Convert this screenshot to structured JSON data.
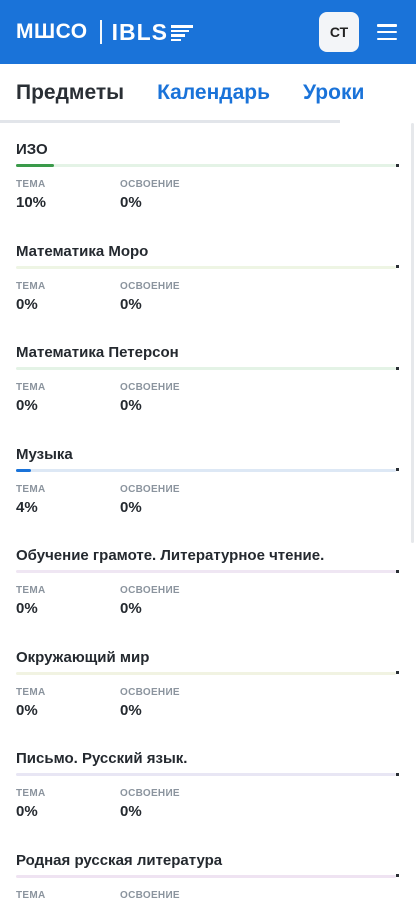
{
  "header": {
    "logo_left": "МШСО",
    "logo_right": "IBLS",
    "avatar_initials": "СТ",
    "menu_icon": "hamburger-icon"
  },
  "tabs": [
    {
      "label": "Предметы",
      "active": true
    },
    {
      "label": "Календарь",
      "active": false
    },
    {
      "label": "Уроки",
      "active": false
    }
  ],
  "column_labels": {
    "topic": "ТЕМА",
    "mastery": "ОСВОЕНИЕ"
  },
  "subjects": [
    {
      "name": "ИЗО",
      "topic": "10%",
      "mastery": "0%",
      "progress": 0.1,
      "track_color": "#e4f3e6",
      "fill_color": "#3a9a4a"
    },
    {
      "name": "Математика Моро",
      "topic": "0%",
      "mastery": "0%",
      "progress": 0,
      "track_color": "#eef5e4",
      "fill_color": "#8bc34a"
    },
    {
      "name": "Математика Петерсон",
      "topic": "0%",
      "mastery": "0%",
      "progress": 0,
      "track_color": "#e4f3e6",
      "fill_color": "#3a9a4a"
    },
    {
      "name": "Музыка",
      "topic": "4%",
      "mastery": "0%",
      "progress": 0.04,
      "track_color": "#dde8f5",
      "fill_color": "#1a73d9"
    },
    {
      "name": "Обучение грамоте. Литературное чтение.",
      "topic": "0%",
      "mastery": "0%",
      "progress": 0,
      "track_color": "#efe6f3",
      "fill_color": "#9c5cb4"
    },
    {
      "name": "Окружающий мир",
      "topic": "0%",
      "mastery": "0%",
      "progress": 0,
      "track_color": "#f1f3e2",
      "fill_color": "#b5bd3a"
    },
    {
      "name": "Письмо. Русский язык.",
      "topic": "0%",
      "mastery": "0%",
      "progress": 0,
      "track_color": "#e8e6f4",
      "fill_color": "#6a5cc0"
    },
    {
      "name": "Родная русская литература",
      "topic": "",
      "mastery": "",
      "progress": 0,
      "track_color": "#efe3f2",
      "fill_color": "#a05cb4"
    }
  ]
}
